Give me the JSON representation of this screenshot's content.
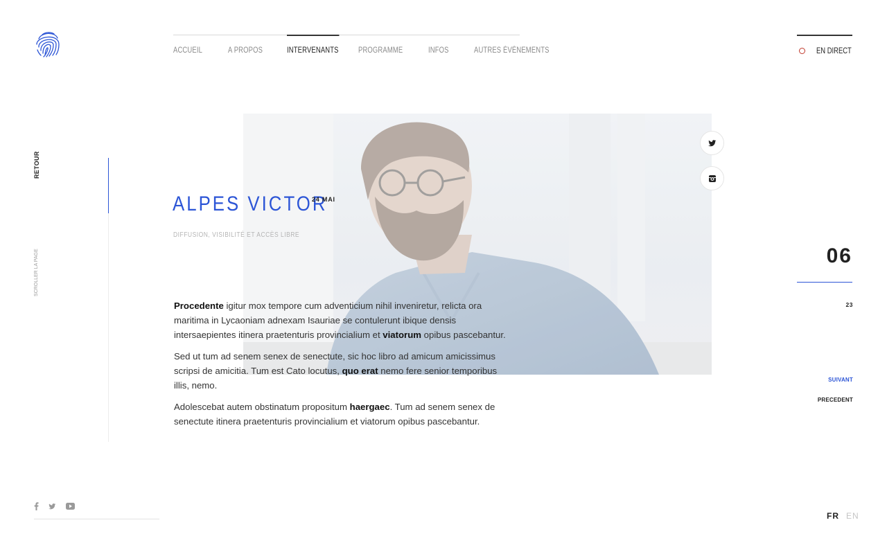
{
  "nav": {
    "items": [
      {
        "label": "ACCUEIL"
      },
      {
        "label": "A PROPOS"
      },
      {
        "label": "INTERVENANTS"
      },
      {
        "label": "PROGRAMME"
      },
      {
        "label": "INFOS"
      },
      {
        "label": "AUTRES ÉVÈNEMENTS"
      }
    ],
    "active": "INTERVENANTS",
    "live_label": "EN DIRECT"
  },
  "sidebar": {
    "back_label": "RETOUR",
    "scroll_label": "SCROLLER LA PAGE"
  },
  "speaker": {
    "name": "ALPES VICTOR",
    "date": "24 MAI",
    "subtitle": "DIFFUSION, VISIBILITÉ ET ACCÈS LIBRE"
  },
  "article": {
    "p1": {
      "strong1": "Procedente",
      "text1": " igitur mox tempore cum adventicium nihil inveniretur, relicta ora maritima in Lycaoniam adnexam Isauriae se contulerunt ibique densis intersaepientes itinera praetenturis provincialium et ",
      "strong2": "viatorum",
      "text2": " opibus pascebantur."
    },
    "p2": {
      "text1": "Sed ut tum ad senem senex de senectute, sic hoc libro ad amicum amicissimus scripsi de amicitia. Tum est Cato locutus, ",
      "strong1": "quo erat",
      "text2": " nemo fere senior temporibus illis, nemo."
    },
    "p3": {
      "text1": "Adolescebat autem obstinatum propositum ",
      "strong1": "haergaec",
      "text2": ". Tum ad senem senex de senectute itinera praetenturis provincialium et viatorum opibus pascebantur."
    }
  },
  "pager": {
    "current": "06",
    "total": "23",
    "next_label": "SUIVANT",
    "prev_label": "PRECEDENT"
  },
  "social": {
    "photo_buttons": [
      "twitter-icon",
      "instagram-icon"
    ],
    "footer_icons": [
      "facebook-icon",
      "twitter-icon",
      "youtube-icon"
    ]
  },
  "lang": {
    "active": "FR",
    "inactive": "EN"
  },
  "colors": {
    "accent": "#2c55d6",
    "live_dot": "#c0392b",
    "text": "#222222",
    "muted": "#b5b5b5"
  }
}
